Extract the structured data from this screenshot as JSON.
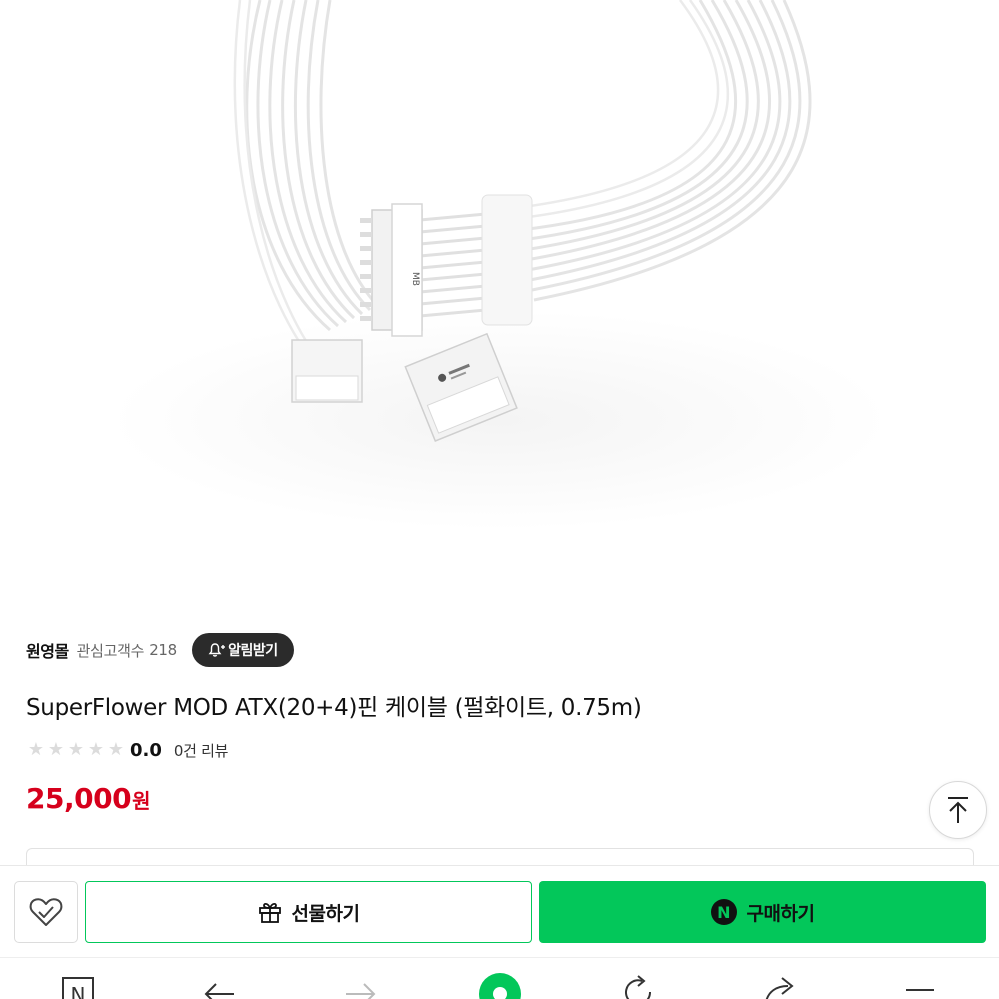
{
  "product": {
    "image_alt": "SuperFlower MOD ATX(20+4)핀 케이블",
    "connector_label": "MB",
    "store_name": "원영몰",
    "interest_label": "관심고객수",
    "interest_count": "218",
    "notify_label": "알림받기",
    "title": "SuperFlower MOD ATX(20+4)핀 케이블 (펄화이트, 0.75m)",
    "rating": {
      "score": "0.0",
      "stars_filled": 0,
      "stars_total": 5,
      "review_text": "0건 리뷰"
    },
    "price": "25,000",
    "price_unit": "원"
  },
  "actions": {
    "wish_icon": "heart-check-icon",
    "gift_label": "선물하기",
    "gift_icon": "gift-icon",
    "buy_label": "구매하기",
    "buy_icon_letter": "N"
  },
  "scroll_top_icon": "arrow-up-to-top-icon",
  "browser_nav": {
    "items": [
      {
        "icon": "naver-home-icon",
        "glyph": "N"
      },
      {
        "icon": "back-arrow-icon"
      },
      {
        "icon": "forward-arrow-icon"
      },
      {
        "icon": "green-dot-icon"
      },
      {
        "icon": "refresh-icon"
      },
      {
        "icon": "share-icon"
      },
      {
        "icon": "menu-icon"
      }
    ]
  },
  "colors": {
    "price_red": "#d6001c",
    "naver_green": "#03c75a",
    "notify_dark": "#2b2b2b"
  }
}
